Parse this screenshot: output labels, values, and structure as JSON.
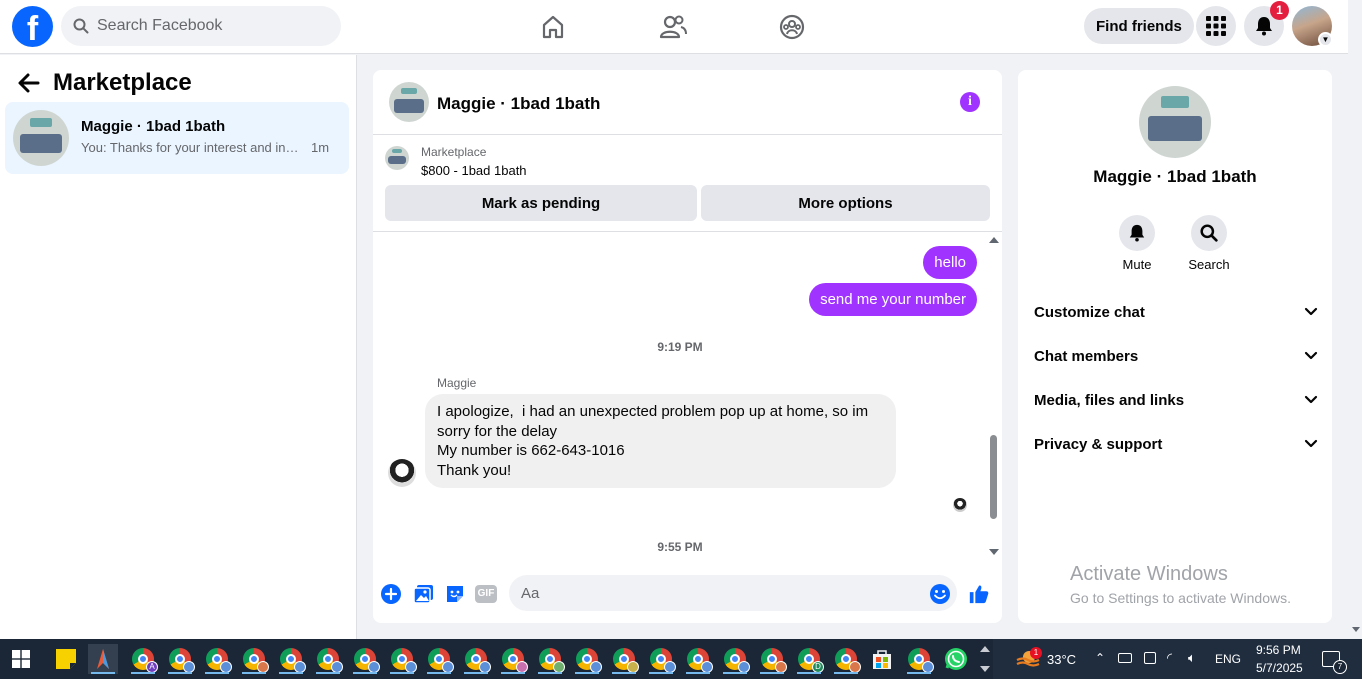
{
  "topbar": {
    "logo_letter": "f",
    "search_placeholder": "Search Facebook",
    "find_friends_label": "Find friends",
    "notification_count": "1"
  },
  "sidebar": {
    "title": "Marketplace",
    "conversations": [
      {
        "name": "Maggie · 1bad 1bath",
        "preview": "You: Thanks for your interest and inquiry",
        "time": "1m"
      }
    ]
  },
  "chat": {
    "title": "Maggie · 1bad 1bath",
    "info_icon": "i",
    "listing": {
      "source": "Marketplace",
      "title": "$800 - 1bad 1bath"
    },
    "buttons": {
      "pending": "Mark as pending",
      "more": "More options"
    },
    "messages": {
      "out1": "hello",
      "out2": "send me your number",
      "timestamp1": "9:19 PM",
      "sender": "Maggie",
      "in_lines": [
        "I apologize,  i had an unexpected problem pop up at home, so im",
        "sorry for the delay",
        "My number is 662-643-1016",
        "Thank you!"
      ],
      "timestamp2": "9:55 PM"
    },
    "composer": {
      "placeholder": "Aa",
      "gif_label": "GIF"
    }
  },
  "details": {
    "name": "Maggie · 1bad 1bath",
    "actions": [
      {
        "label": "Mute",
        "icon": "bell-icon"
      },
      {
        "label": "Search",
        "icon": "search-icon"
      }
    ],
    "sections": [
      "Customize chat",
      "Chat members",
      "Media, files and links",
      "Privacy & support"
    ]
  },
  "watermark": {
    "line1": "Activate Windows",
    "line2": "Go to Settings to activate Windows."
  },
  "taskbar": {
    "weather_badge": "1",
    "temperature": "33°C",
    "language": "ENG",
    "time": "9:56 PM",
    "date": "5/7/2025",
    "notif_count": "7",
    "chrome_badges": [
      "A",
      "D"
    ]
  },
  "colors": {
    "facebook_blue": "#0866ff",
    "message_purple": "#a033ff",
    "selected_conversation": "#ebf5ff",
    "taskbar": "#1b2636"
  }
}
